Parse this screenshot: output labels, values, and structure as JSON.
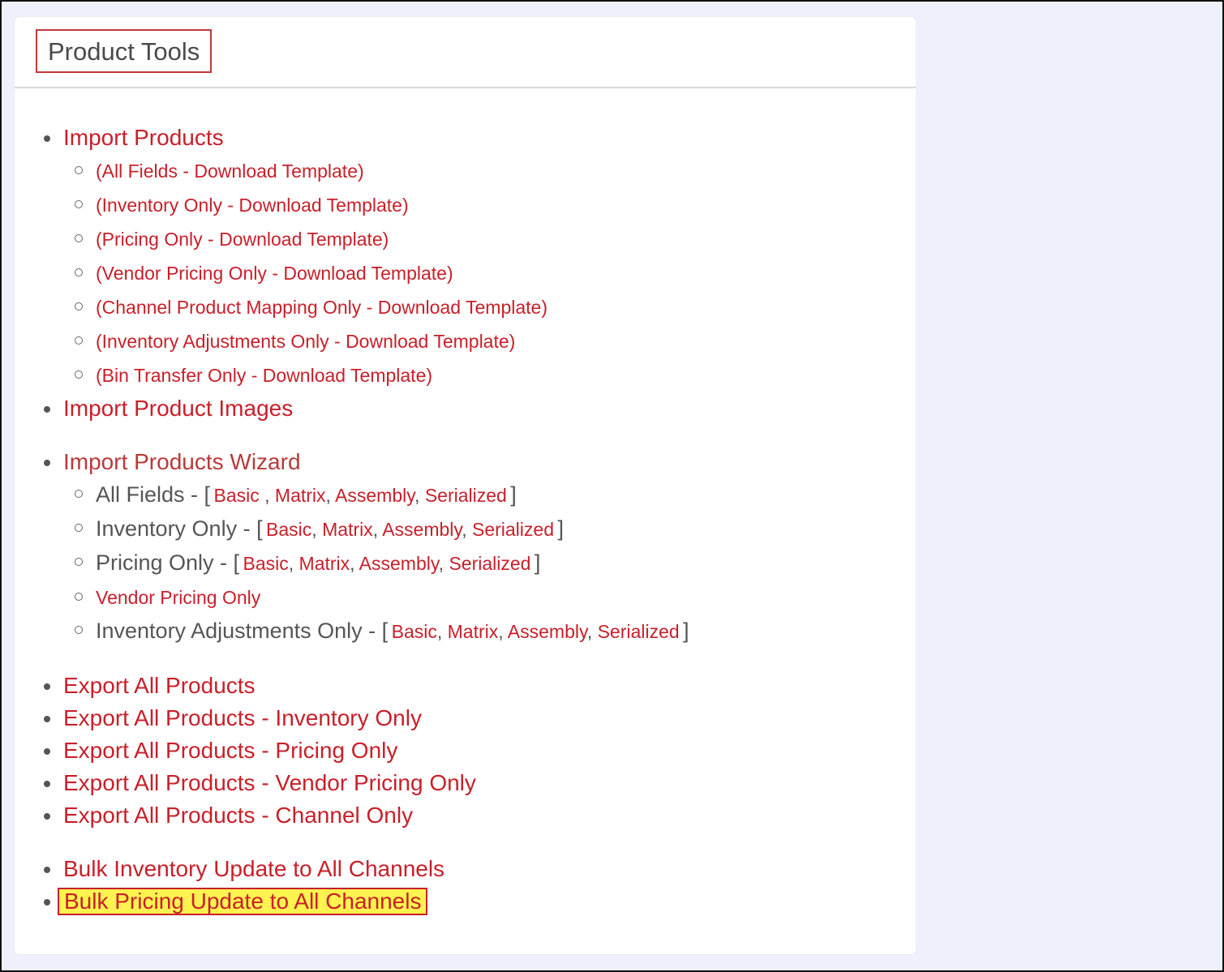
{
  "panel": {
    "title": "Product Tools"
  },
  "import_products": {
    "label": "Import Products",
    "templates": [
      "(All Fields - Download Template)",
      "(Inventory Only - Download Template)",
      "(Pricing Only - Download Template)",
      "(Vendor Pricing Only - Download Template)",
      "(Channel Product Mapping Only - Download Template)",
      "(Inventory Adjustments Only - Download Template)",
      "(Bin Transfer Only - Download Template)"
    ]
  },
  "import_product_images": {
    "label": "Import Product Images"
  },
  "wizard": {
    "label": "Import Products Wizard",
    "all_fields_label": "All Fields - [",
    "inventory_only_label": "Inventory Only - [",
    "pricing_only_label": "Pricing Only - [",
    "vendor_pricing_only": "Vendor Pricing Only",
    "inventory_adjustments_label": "Inventory Adjustments Only - [",
    "basic": "Basic",
    "matrix": "Matrix",
    "assembly": "Assembly",
    "serialized": "Serialized",
    "close_bracket": "]"
  },
  "exports": [
    "Export All Products",
    "Export All Products - Inventory Only",
    "Export All Products - Pricing Only",
    "Export All Products - Vendor Pricing Only",
    "Export All Products - Channel Only"
  ],
  "bulk": {
    "inventory": "Bulk Inventory Update to All Channels",
    "pricing": "Bulk Pricing Update to All Channels"
  },
  "colors": {
    "link": "#c8202a",
    "highlight": "#fff44f",
    "highlight_border": "#c8202a",
    "title_border": "#c0393b"
  }
}
